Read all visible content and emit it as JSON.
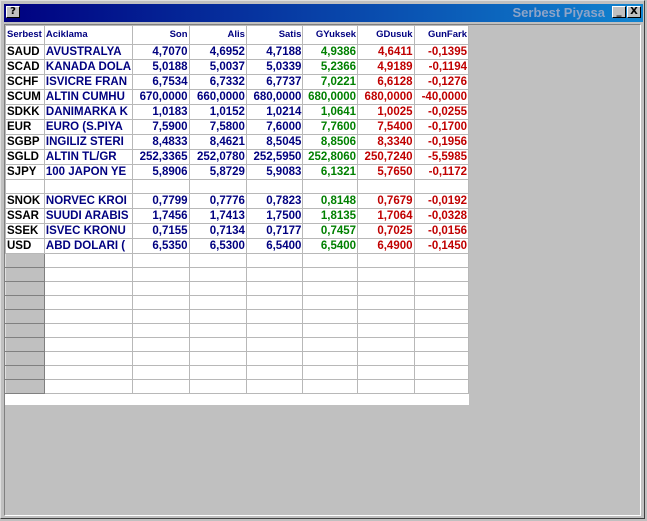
{
  "window": {
    "title": "Serbest Piyasa",
    "sys_icon": "?",
    "minimize_glyph": "_",
    "close_glyph": "X"
  },
  "colors": {
    "header_text": "#000080",
    "desc": "#000080",
    "gyuksek": "#008000",
    "gdusuk": "#c00000",
    "gunfark": "#c00000"
  },
  "columns": [
    "Serbest",
    "Aciklama",
    "Son",
    "Alis",
    "Satis",
    "GYuksek",
    "GDusuk",
    "GunFark"
  ],
  "rows": [
    {
      "code": "SAUD",
      "desc": "AVUSTRALYA",
      "son": "4,7070",
      "alis": "4,6952",
      "satis": "4,7188",
      "gyuksek": "4,9386",
      "gdusuk": "4,6411",
      "gunfark": "-0,1395"
    },
    {
      "code": "SCAD",
      "desc": "KANADA DOLA",
      "son": "5,0188",
      "alis": "5,0037",
      "satis": "5,0339",
      "gyuksek": "5,2366",
      "gdusuk": "4,9189",
      "gunfark": "-0,1194"
    },
    {
      "code": "SCHF",
      "desc": "ISVICRE FRAN",
      "son": "6,7534",
      "alis": "6,7332",
      "satis": "6,7737",
      "gyuksek": "7,0221",
      "gdusuk": "6,6128",
      "gunfark": "-0,1276"
    },
    {
      "code": "SCUM",
      "desc": "ALTIN CUMHU",
      "son": "670,0000",
      "alis": "660,0000",
      "satis": "680,0000",
      "gyuksek": "680,0000",
      "gdusuk": "680,0000",
      "gunfark": "-40,0000"
    },
    {
      "code": "SDKK",
      "desc": "DANIMARKA K",
      "son": "1,0183",
      "alis": "1,0152",
      "satis": "1,0214",
      "gyuksek": "1,0641",
      "gdusuk": "1,0025",
      "gunfark": "-0,0255"
    },
    {
      "code": "EUR",
      "desc": "EURO (S.PIYA",
      "son": "7,5900",
      "alis": "7,5800",
      "satis": "7,6000",
      "gyuksek": "7,7600",
      "gdusuk": "7,5400",
      "gunfark": "-0,1700"
    },
    {
      "code": "SGBP",
      "desc": "INGILIZ STERI",
      "son": "8,4833",
      "alis": "8,4621",
      "satis": "8,5045",
      "gyuksek": "8,8506",
      "gdusuk": "8,3340",
      "gunfark": "-0,1956"
    },
    {
      "code": "SGLD",
      "desc": "ALTIN TL/GR",
      "son": "252,3365",
      "alis": "252,0780",
      "satis": "252,5950",
      "gyuksek": "252,8060",
      "gdusuk": "250,7240",
      "gunfark": "-5,5985"
    },
    {
      "code": "SJPY",
      "desc": "100 JAPON YE",
      "son": "5,8906",
      "alis": "5,8729",
      "satis": "5,9083",
      "gyuksek": "6,1321",
      "gdusuk": "5,7650",
      "gunfark": "-0,1172"
    },
    {
      "code": "",
      "desc": "",
      "son": "",
      "alis": "",
      "satis": "",
      "gyuksek": "",
      "gdusuk": "",
      "gunfark": ""
    },
    {
      "code": "SNOK",
      "desc": "NORVEC KROI",
      "son": "0,7799",
      "alis": "0,7776",
      "satis": "0,7823",
      "gyuksek": "0,8148",
      "gdusuk": "0,7679",
      "gunfark": "-0,0192"
    },
    {
      "code": "SSAR",
      "desc": "SUUDI ARABIS",
      "son": "1,7456",
      "alis": "1,7413",
      "satis": "1,7500",
      "gyuksek": "1,8135",
      "gdusuk": "1,7064",
      "gunfark": "-0,0328"
    },
    {
      "code": "SSEK",
      "desc": "ISVEC KRONU",
      "son": "0,7155",
      "alis": "0,7134",
      "satis": "0,7177",
      "gyuksek": "0,7457",
      "gdusuk": "0,7025",
      "gunfark": "-0,0156"
    },
    {
      "code": "USD",
      "desc": "ABD DOLARI (",
      "son": "6,5350",
      "alis": "6,5300",
      "satis": "6,5400",
      "gyuksek": "6,5400",
      "gdusuk": "6,4900",
      "gunfark": "-0,1450"
    }
  ],
  "empty_rows": 10
}
